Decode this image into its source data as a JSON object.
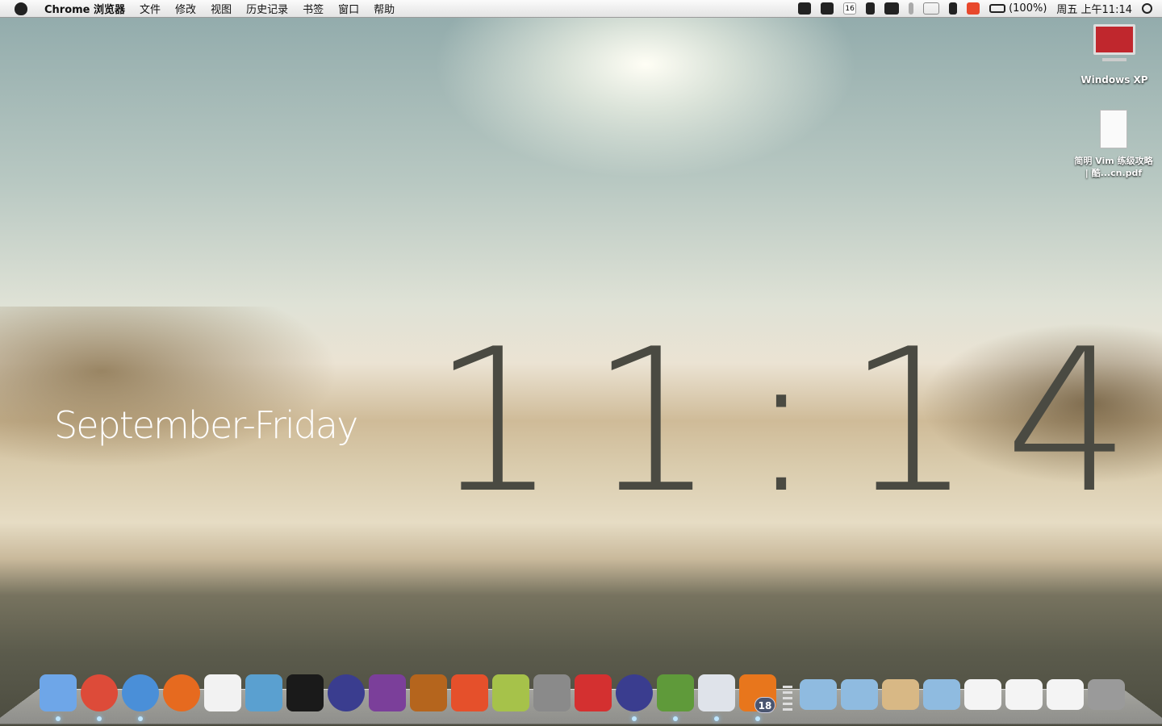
{
  "menubar": {
    "app": "Chrome 浏览器",
    "items": [
      "文件",
      "修改",
      "视图",
      "历史记录",
      "书签",
      "窗口",
      "帮助"
    ],
    "status": {
      "calendar_day": "16",
      "battery": "(100%)",
      "clock": "周五 上午11:14"
    },
    "status_icons": [
      "growl-icon",
      "notification-icon",
      "calendar-icon",
      "lock-icon",
      "display-icon",
      "bluetooth-icon",
      "wifi-icon",
      "volume-icon",
      "sogou-input-icon",
      "battery-icon",
      "spotlight-icon"
    ]
  },
  "desktop": {
    "clock": "11:14",
    "date": "September-Friday",
    "icons": [
      {
        "label": "Windows XP",
        "icon": "parallels-vm-icon"
      },
      {
        "label": "简明 Vim 练级攻略 | 酷...cn.pdf",
        "icon": "pdf-document-icon"
      }
    ]
  },
  "dock": {
    "apps": [
      {
        "name": "finder",
        "color": "#6ea6e8",
        "running": true
      },
      {
        "name": "chrome",
        "color": "#dd4b39",
        "running": true
      },
      {
        "name": "safari",
        "color": "#4a8fd8",
        "running": true
      },
      {
        "name": "firefox",
        "color": "#e66a1f",
        "running": false
      },
      {
        "name": "ical",
        "color": "#f2f2f2",
        "running": false
      },
      {
        "name": "network-utility",
        "color": "#5aa0d0",
        "running": false
      },
      {
        "name": "terminal",
        "color": "#1a1a1a",
        "running": false
      },
      {
        "name": "eclipse",
        "color": "#3a3d8f",
        "running": false
      },
      {
        "name": "xcode-tool",
        "color": "#7b3f9a",
        "running": false
      },
      {
        "name": "keynote",
        "color": "#b5651d",
        "running": false
      },
      {
        "name": "p-app",
        "color": "#e5502b",
        "running": false
      },
      {
        "name": "pear-app",
        "color": "#a6c24a",
        "running": false
      },
      {
        "name": "system-preferences",
        "color": "#8a8a8a",
        "running": false
      },
      {
        "name": "m-app",
        "color": "#d43030",
        "running": false
      },
      {
        "name": "eclipse-2",
        "color": "#3a3d8f",
        "running": true
      },
      {
        "name": "lotus-app",
        "color": "#5f9a3a",
        "running": true
      },
      {
        "name": "textedit",
        "color": "#dfe3ea",
        "running": true
      },
      {
        "name": "sublime-text",
        "color": "#e8761c",
        "running": true,
        "badge": "18"
      }
    ],
    "stacks": [
      {
        "name": "applications-folder",
        "color": "#8fbbe0"
      },
      {
        "name": "documents-folder",
        "color": "#8fbbe0"
      },
      {
        "name": "downloads-stack",
        "color": "#d8b885"
      },
      {
        "name": "windows-folder",
        "color": "#8fbbe0"
      },
      {
        "name": "eclipse-window",
        "color": "#f4f4f4"
      },
      {
        "name": "chrome-window",
        "color": "#f4f4f4"
      },
      {
        "name": "finder-window",
        "color": "#f4f4f4"
      },
      {
        "name": "trash",
        "color": "#9a9a9a"
      }
    ]
  }
}
